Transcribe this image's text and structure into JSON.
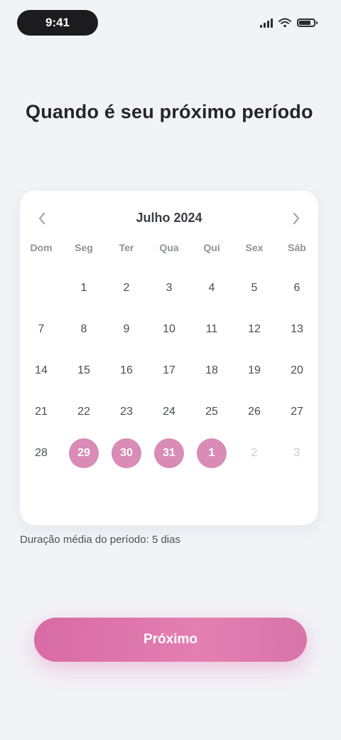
{
  "status_bar": {
    "time": "9:41",
    "signal_icon": "signal-icon",
    "wifi_icon": "wifi-icon",
    "battery_level": 0.8
  },
  "title": "Quando é seu próximo período",
  "calendar": {
    "month_label": "Julho 2024",
    "prev_icon": "chevron-left-icon",
    "next_icon": "chevron-right-icon",
    "weekdays": [
      "Dom",
      "Seg",
      "Ter",
      "Qua",
      "Qui",
      "Sex",
      "Sáb"
    ],
    "weeks": [
      [
        {
          "n": "",
          "state": "empty"
        },
        {
          "n": "1",
          "state": "normal"
        },
        {
          "n": "2",
          "state": "normal"
        },
        {
          "n": "3",
          "state": "normal"
        },
        {
          "n": "4",
          "state": "normal"
        },
        {
          "n": "5",
          "state": "normal"
        },
        {
          "n": "6",
          "state": "normal"
        }
      ],
      [
        {
          "n": "7",
          "state": "normal"
        },
        {
          "n": "8",
          "state": "normal"
        },
        {
          "n": "9",
          "state": "normal"
        },
        {
          "n": "10",
          "state": "normal"
        },
        {
          "n": "11",
          "state": "normal"
        },
        {
          "n": "12",
          "state": "normal"
        },
        {
          "n": "13",
          "state": "normal"
        }
      ],
      [
        {
          "n": "14",
          "state": "normal"
        },
        {
          "n": "15",
          "state": "normal"
        },
        {
          "n": "16",
          "state": "normal"
        },
        {
          "n": "17",
          "state": "normal"
        },
        {
          "n": "18",
          "state": "normal"
        },
        {
          "n": "19",
          "state": "normal"
        },
        {
          "n": "20",
          "state": "normal"
        }
      ],
      [
        {
          "n": "21",
          "state": "normal"
        },
        {
          "n": "22",
          "state": "normal"
        },
        {
          "n": "23",
          "state": "normal"
        },
        {
          "n": "24",
          "state": "normal"
        },
        {
          "n": "25",
          "state": "normal"
        },
        {
          "n": "26",
          "state": "normal"
        },
        {
          "n": "27",
          "state": "normal"
        }
      ],
      [
        {
          "n": "28",
          "state": "normal"
        },
        {
          "n": "29",
          "state": "selected"
        },
        {
          "n": "30",
          "state": "selected"
        },
        {
          "n": "31",
          "state": "selected"
        },
        {
          "n": "1",
          "state": "selected"
        },
        {
          "n": "2",
          "state": "muted"
        },
        {
          "n": "3",
          "state": "muted"
        }
      ]
    ]
  },
  "note": "Duração média do período: 5 dias",
  "cta_label": "Próximo",
  "colors": {
    "accent": "#e07aae",
    "selected_day": "#d98cb5",
    "background": "#f2f3f7"
  }
}
